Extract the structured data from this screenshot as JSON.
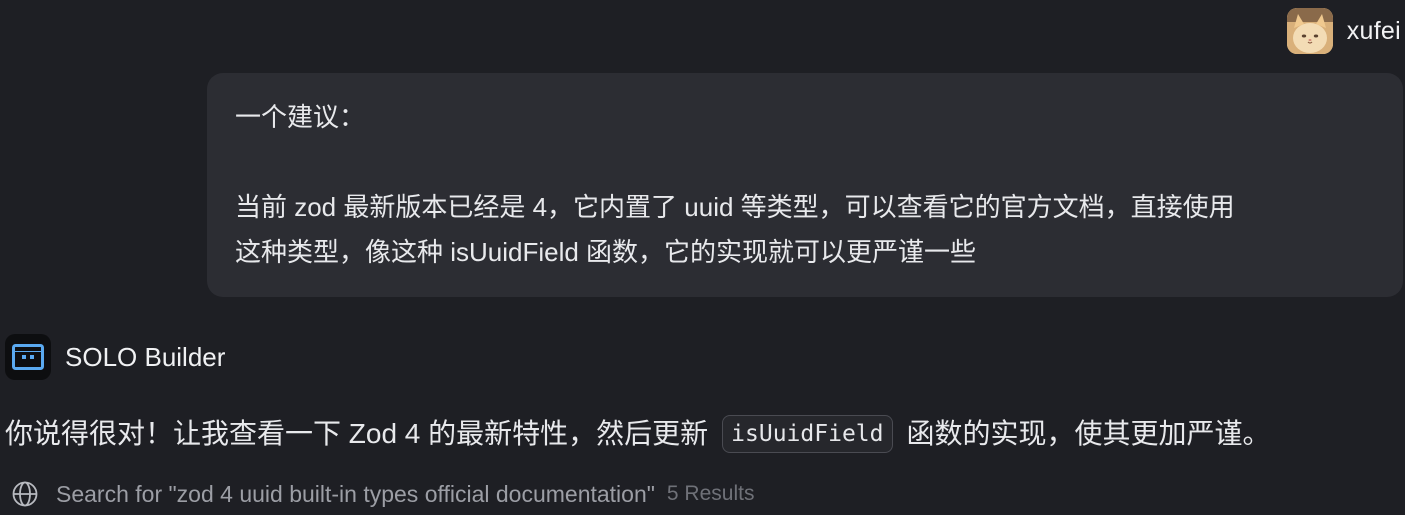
{
  "user": {
    "name": "xufei",
    "avatar_icon": "cat-avatar"
  },
  "user_message": {
    "line1": "一个建议：",
    "line2": "当前 zod 最新版本已经是 4，它内置了 uuid 等类型，可以查看它的官方文档，直接使用",
    "line3": "这种类型，像这种 isUuidField 函数，它的实现就可以更严谨一些"
  },
  "assistant": {
    "name": "SOLO Builder",
    "icon": "robot-icon",
    "reply_before": "你说得很对！让我查看一下 Zod 4 的最新特性，然后更新",
    "reply_code": "isUuidField",
    "reply_after": "函数的实现，使其更加严谨。"
  },
  "search": {
    "icon": "globe-icon",
    "text": "Search for \"zod 4 uuid built-in types official documentation\"",
    "count": "5 Results"
  },
  "colors": {
    "background": "#1e1f24",
    "bubble": "#2c2d33",
    "bot_accent": "#5aa9f0"
  }
}
